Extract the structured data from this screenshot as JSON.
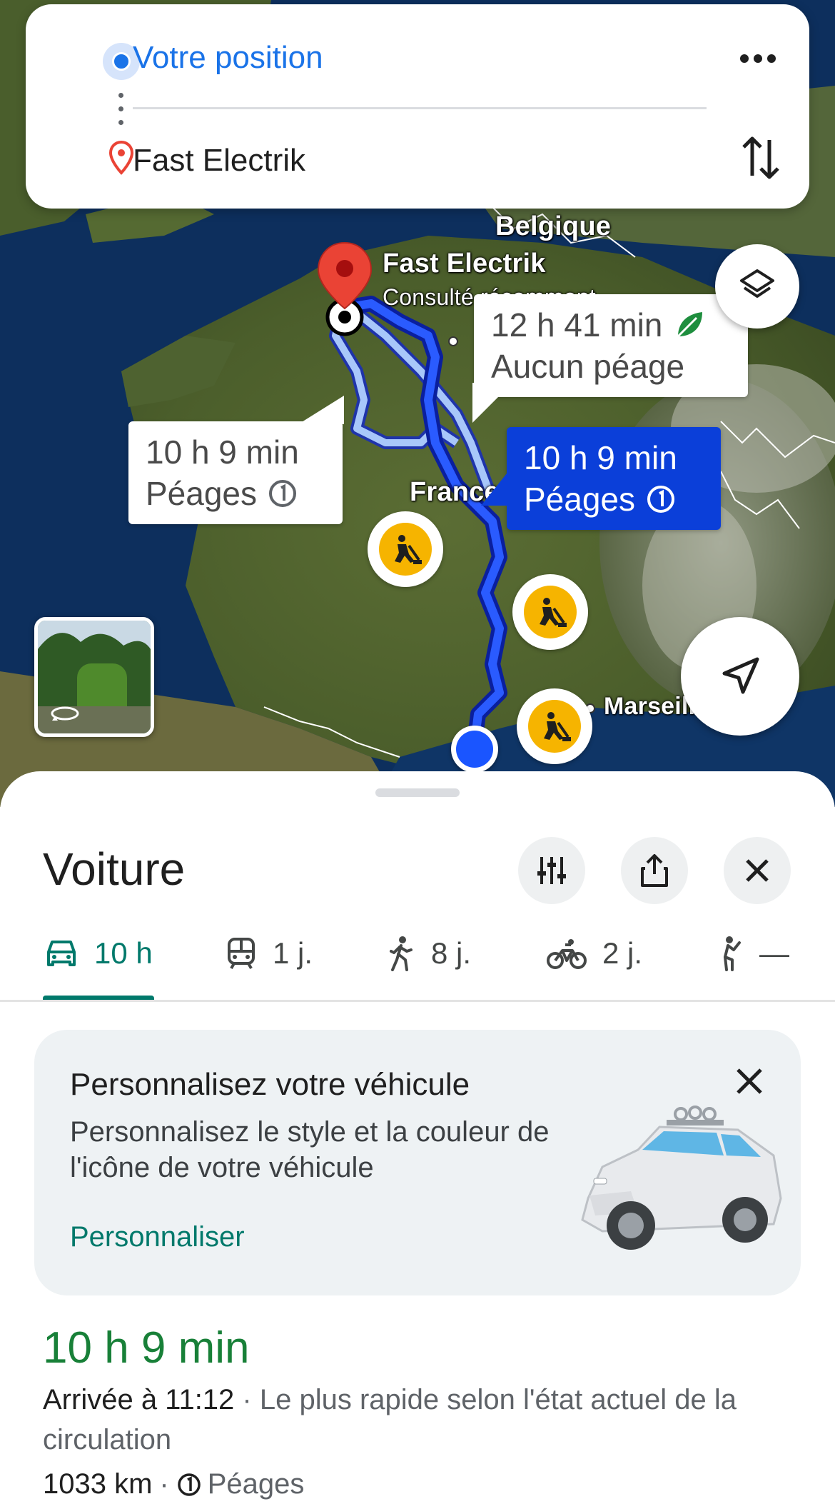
{
  "search": {
    "origin": "Votre position",
    "destination": "Fast Electrik"
  },
  "map": {
    "labels": {
      "belgium": "Belgique",
      "destination_name": "Fast Electrik",
      "destination_sub": "Consulté récemment",
      "france": "France",
      "marseille": "Marseille"
    },
    "routes": [
      {
        "time": "12 h 41 min",
        "note": "Aucun péage",
        "eco": true,
        "selected": false
      },
      {
        "time": "10 h 9 min",
        "note": "Péages",
        "eco": false,
        "selected": false
      },
      {
        "time": "10 h 9 min",
        "note": "Péages",
        "eco": false,
        "selected": true
      }
    ]
  },
  "sheet": {
    "title": "Voiture",
    "modes": [
      {
        "icon": "car-icon",
        "label": "10 h",
        "active": true
      },
      {
        "icon": "train-icon",
        "label": "1 j.",
        "active": false
      },
      {
        "icon": "walk-icon",
        "label": "8 j.",
        "active": false
      },
      {
        "icon": "bike-icon",
        "label": "2 j.",
        "active": false
      },
      {
        "icon": "ride-hailing-icon",
        "label": "—",
        "active": false
      }
    ],
    "promo": {
      "title": "Personnalisez votre véhicule",
      "body": "Personnalisez le style et la couleur de l'icône de votre véhicule",
      "link": "Personnaliser"
    },
    "summary": {
      "duration": "10 h 9 min",
      "arrival": "Arrivée à 11:12",
      "note": " · Le plus rapide selon l'état actuel de la circulation",
      "distance": "1033 km",
      "tolls": "Péages"
    }
  },
  "colors": {
    "accent_blue": "#1a73e8",
    "route_selected": "#0b3fd9",
    "teal": "#00796b",
    "duration_green": "#188038"
  }
}
